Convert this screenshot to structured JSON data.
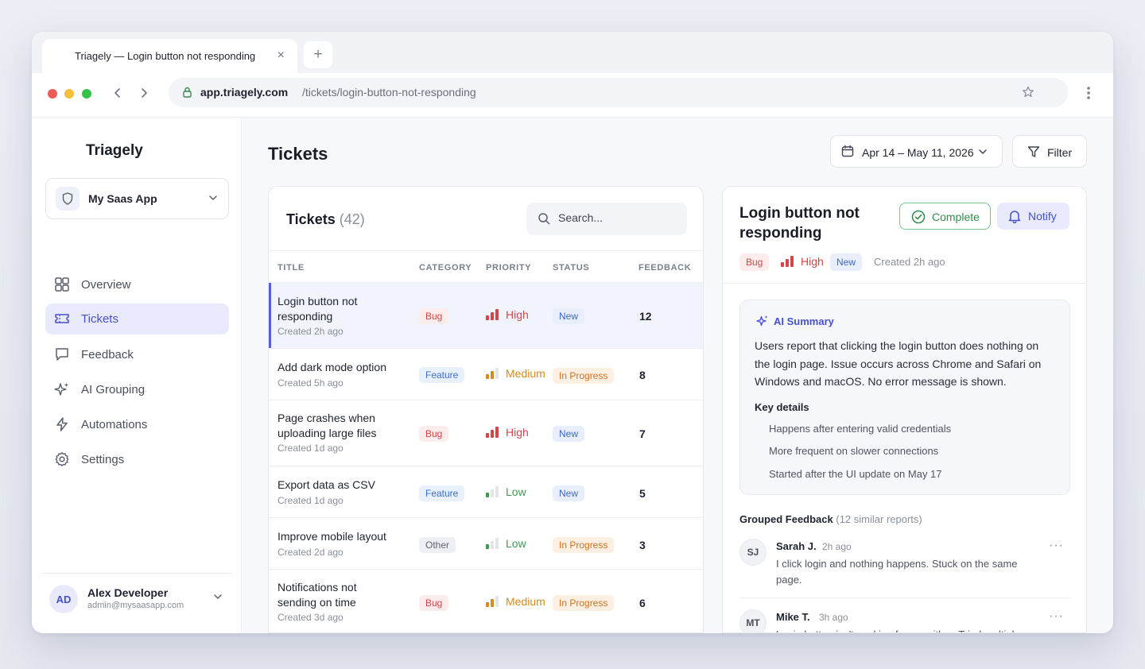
{
  "browser": {
    "tab_title": "Triagely — Login button not responding",
    "tab_close": "×",
    "new_tab": "+",
    "url_host": "app.triagely.com",
    "url_path": "/tickets/login-button-not-responding"
  },
  "sidebar": {
    "brand": "Triagely",
    "app_selector": "My Saas App",
    "items": [
      {
        "label": "Overview",
        "icon": "grid-icon"
      },
      {
        "label": "Tickets",
        "icon": "ticket-icon",
        "active": true
      },
      {
        "label": "Feedback",
        "icon": "message-icon"
      },
      {
        "label": "AI Grouping",
        "icon": "sparkle-icon"
      },
      {
        "label": "Automations",
        "icon": "bolt-icon"
      },
      {
        "label": "Settings",
        "icon": "gear-icon"
      }
    ],
    "user": {
      "initials": "AD",
      "name": "Alex Developer",
      "email": "admin@mysaasapp.com"
    }
  },
  "header": {
    "title": "Tickets",
    "date_range": "Apr 14 – May 11, 2026",
    "filter_label": "Filter"
  },
  "tickets": {
    "title": "Tickets",
    "count": "(42)",
    "search_placeholder": "Search...",
    "columns": [
      "TITLE",
      "CATEGORY",
      "PRIORITY",
      "STATUS",
      "FEEDBACK"
    ],
    "rows": [
      {
        "title": "Login button not responding",
        "created": "Created 2h ago",
        "category": "Bug",
        "priority": "High",
        "status": "New",
        "feedback": "12",
        "selected": true
      },
      {
        "title": "Add dark mode option",
        "created": "Created 5h ago",
        "category": "Feature",
        "priority": "Medium",
        "status": "In Progress",
        "feedback": "8"
      },
      {
        "title": "Page crashes when uploading large files",
        "created": "Created 1d ago",
        "category": "Bug",
        "priority": "High",
        "status": "New",
        "feedback": "7"
      },
      {
        "title": "Export data as CSV",
        "created": "Created 1d ago",
        "category": "Feature",
        "priority": "Low",
        "status": "New",
        "feedback": "5"
      },
      {
        "title": "Improve mobile layout",
        "created": "Created 2d ago",
        "category": "Other",
        "priority": "Low",
        "status": "In Progress",
        "feedback": "3"
      },
      {
        "title": "Notifications not sending on time",
        "created": "Created 3d ago",
        "category": "Bug",
        "priority": "Medium",
        "status": "In Progress",
        "feedback": "6"
      }
    ]
  },
  "detail": {
    "title": "Login button not responding",
    "complete_label": "Complete",
    "notify_label": "Notify",
    "category": "Bug",
    "priority": "High",
    "status": "New",
    "created": "Created 2h ago",
    "ai_summary_label": "AI Summary",
    "ai_summary_text": "Users report that clicking the login button does nothing on the login page. Issue occurs across Chrome and Safari on Windows and macOS. No error message is shown.",
    "key_details_label": "Key details",
    "key_details": [
      "Happens after entering valid credentials",
      "More frequent on slower connections",
      "Started after the UI update on May 17"
    ],
    "grouped_label": "Grouped Feedback",
    "grouped_count": "(12 similar reports)",
    "feedback": [
      {
        "initials": "SJ",
        "name": "Sarah J.",
        "time": "2h ago",
        "text": "I click login and nothing happens. Stuck on the same page."
      },
      {
        "initials": "MT",
        "name": "Mike T.",
        "time": "3h ago",
        "text": "Login button isn't working for me either. Tried multiple times."
      }
    ],
    "more": "···"
  },
  "colors": {
    "accent": "#4551c9",
    "high": "#d64545",
    "medium": "#d88a1d",
    "low": "#3e9a52",
    "complete": "#2f8c4a"
  }
}
